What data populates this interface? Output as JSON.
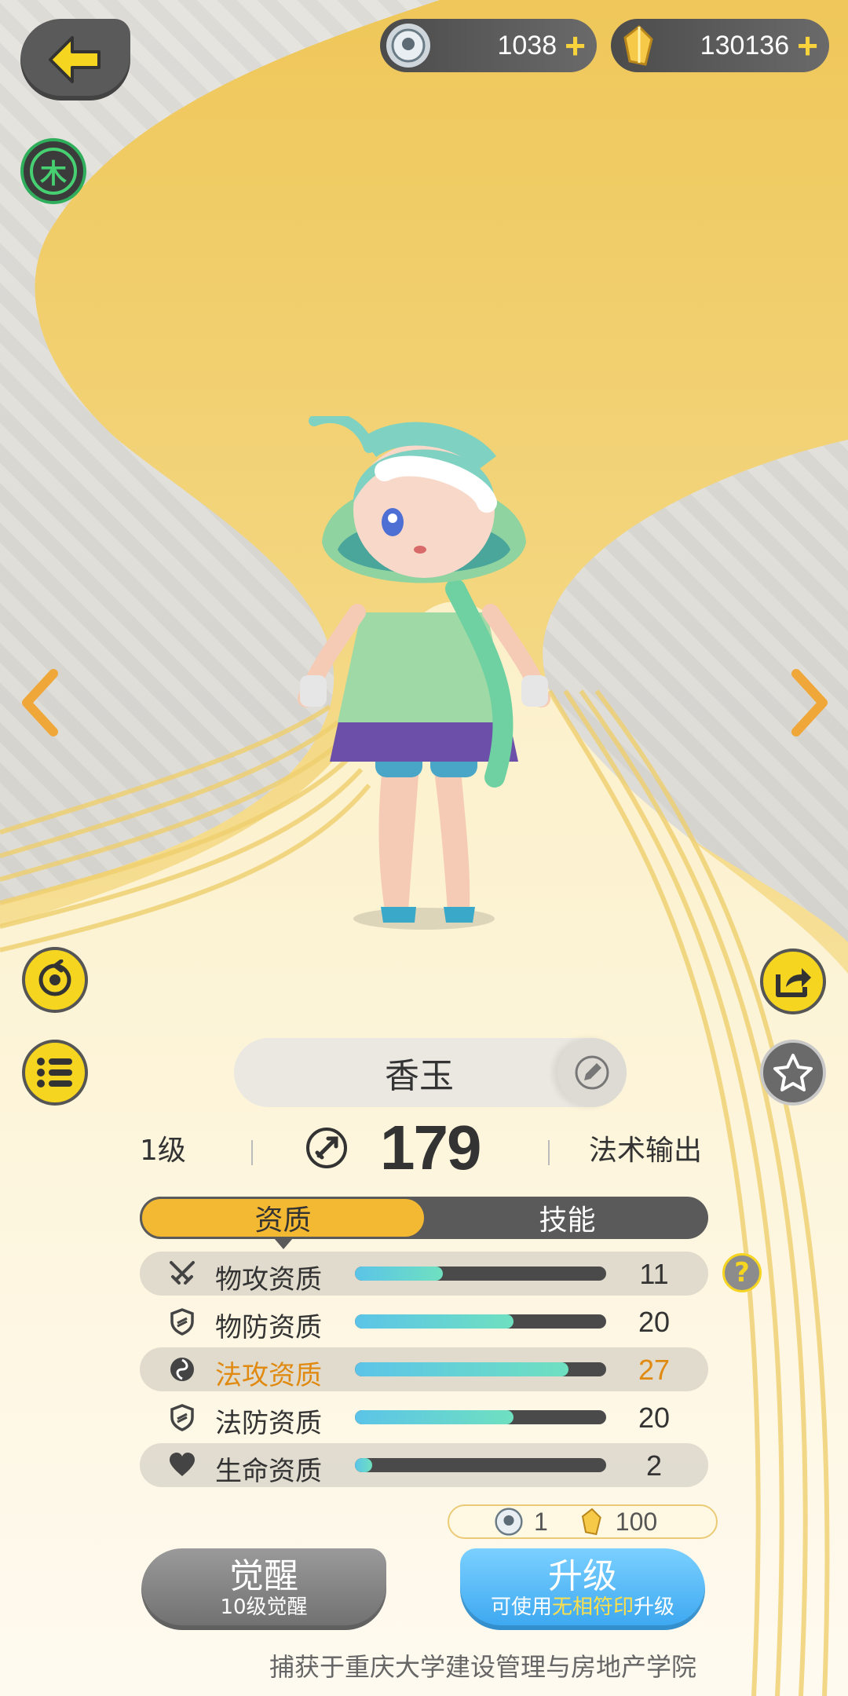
{
  "header": {
    "back_icon": "arrow-left-icon",
    "resources": [
      {
        "icon": "seal-coin-icon",
        "value": "1038",
        "plus": "+"
      },
      {
        "icon": "crystal-icon",
        "value": "130136",
        "plus": "+"
      }
    ]
  },
  "element_badge": {
    "label": "木",
    "color": "#47d071"
  },
  "character": {
    "name": "香玉",
    "level": "1级",
    "power": "179",
    "role": "法术输出"
  },
  "tabs": [
    {
      "label": "资质",
      "active": true
    },
    {
      "label": "技能",
      "active": false
    }
  ],
  "stats": [
    {
      "icon": "swords-icon",
      "label": "物攻资质",
      "value": "11",
      "fill": 0.35,
      "highlight": false
    },
    {
      "icon": "shield-icon",
      "label": "物防资质",
      "value": "20",
      "fill": 0.63,
      "highlight": false
    },
    {
      "icon": "magic-orb-icon",
      "label": "法攻资质",
      "value": "27",
      "fill": 0.85,
      "highlight": true
    },
    {
      "icon": "shield-icon",
      "label": "法防资质",
      "value": "20",
      "fill": 0.63,
      "highlight": false
    },
    {
      "icon": "heart-icon",
      "label": "生命资质",
      "value": "2",
      "fill": 0.07,
      "highlight": false
    }
  ],
  "cost": [
    {
      "icon": "seal-coin-icon",
      "value": "1"
    },
    {
      "icon": "crystal-icon",
      "value": "100"
    }
  ],
  "buttons": {
    "awaken_main": "觉醒",
    "awaken_sub": "10级觉醒",
    "upgrade_main": "升级",
    "upgrade_sub_prefix": "可使用",
    "upgrade_sub_highlight": "无相符印",
    "upgrade_sub_suffix": "升级"
  },
  "footer": "捕获于重庆大学建设管理与房地产学院",
  "colors": {
    "accent": "#f4b933",
    "highlight": "#e08a12",
    "bar": "#5bc4e8"
  }
}
